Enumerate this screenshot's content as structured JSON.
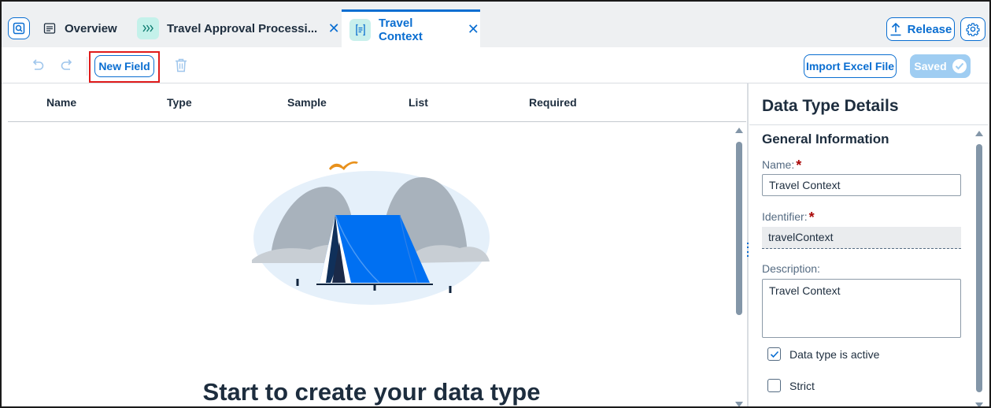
{
  "tabs": {
    "overview": "Overview",
    "process": "Travel Approval Processi...",
    "active": "Travel Context",
    "close_glyph": "✕"
  },
  "header_actions": {
    "release_label": "Release",
    "release_icon": "upload-icon",
    "settings_icon": "gear-icon"
  },
  "toolbar": {
    "new_field_label": "New Field",
    "import_label": "Import Excel File",
    "saved_label": "Saved",
    "icons": [
      "undo-icon",
      "redo-icon",
      "delete-icon"
    ]
  },
  "table": {
    "columns": [
      "Name",
      "Type",
      "Sample",
      "List",
      "Required"
    ]
  },
  "empty_state": {
    "title": "Start to create your data type"
  },
  "details": {
    "title": "Data Type Details",
    "section": "General Information",
    "name_label": "Name:",
    "name_value": "Travel Context",
    "identifier_label": "Identifier:",
    "identifier_value": "travelContext",
    "description_label": "Description:",
    "description_value": "Travel Context",
    "required_mark": "*",
    "active_label": "Data type is active",
    "active_checked": true,
    "strict_label": "Strict",
    "strict_checked": false
  },
  "colors": {
    "accent": "#0a6ed1",
    "tent": "#0070f2",
    "highlight": "#e01b1b",
    "required": "#aa0808"
  }
}
